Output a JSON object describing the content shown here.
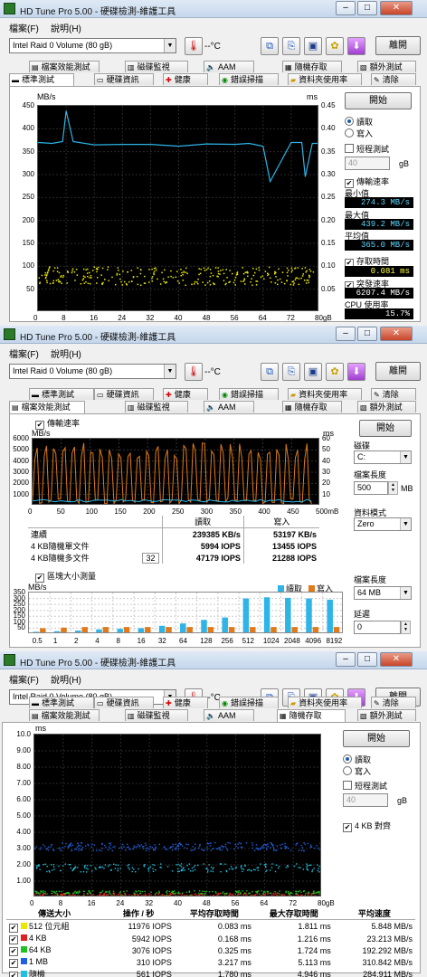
{
  "app": {
    "title": "HD Tune Pro  5.00 - 硬碟檢測-維護工具",
    "menu": [
      "檔案(F)",
      "說明(H)"
    ],
    "drive": "Intel   Raid 0 Volume (80 gB)",
    "temperature": "--°C",
    "exit_label": "離開",
    "window_buttons": {
      "minimize": "–",
      "maximize": "□",
      "close": "✕"
    }
  },
  "tabs": {
    "row_top": [
      "檔案效能測試",
      "磁碟監視",
      "AAM",
      "隨機存取",
      "額外測試"
    ],
    "row_bottom": [
      "標準測試",
      "硬碟資訊",
      "健康",
      "錯誤掃描",
      "資料夾使用率",
      "清除"
    ]
  },
  "panel1": {
    "start_label": "開始",
    "read_label": "讀取",
    "write_label": "寫入",
    "short_stroke_label": "短程測試",
    "short_stroke_value": "40",
    "short_stroke_unit": "gB",
    "transfer_rate_label": "傳輸速率",
    "min_label": "最小值",
    "min_value": "274.3 MB/s",
    "max_label": "最大值",
    "max_value": "439.2 MB/s",
    "avg_label": "平均值",
    "avg_value": "365.0 MB/s",
    "access_time_label": "存取時間",
    "access_time_value": "0.081 ms",
    "burst_rate_label": "突發速率",
    "burst_rate_value": "6207.4 MB/s",
    "cpu_label": "CPU 使用率",
    "cpu_value": "15.7%",
    "chart": {
      "y_unit_left": "MB/s",
      "y_unit_right": "ms",
      "y_ticks_left": [
        "450",
        "400",
        "350",
        "300",
        "250",
        "200",
        "150",
        "100",
        "50"
      ],
      "y_ticks_right": [
        "0.45",
        "0.40",
        "0.35",
        "0.30",
        "0.25",
        "0.20",
        "0.15",
        "0.10",
        "0.05"
      ],
      "x_ticks": [
        "0",
        "8",
        "16",
        "24",
        "32",
        "40",
        "48",
        "56",
        "64",
        "72",
        "80gB"
      ]
    }
  },
  "panel2": {
    "transfer_rate_label": "傳輸速率",
    "start_label": "開始",
    "disk_label": "磁碟",
    "disk_value": "C:",
    "file_length_label": "檔案長度",
    "file_length_value": "500",
    "file_length_unit": "MB",
    "data_pattern_label": "資料模式",
    "data_pattern_value": "Zero",
    "chart": {
      "y_unit_left": "MB/s",
      "y_unit_right": "ms",
      "y_ticks_left": [
        "6000",
        "5000",
        "4000",
        "3000",
        "2000",
        "1000"
      ],
      "y_ticks_right": [
        "60",
        "50",
        "40",
        "30",
        "20",
        "10"
      ],
      "x_ticks": [
        "0",
        "50",
        "100",
        "150",
        "200",
        "250",
        "300",
        "350",
        "400",
        "450",
        "500mB"
      ]
    },
    "table": {
      "headers": [
        "",
        "",
        "讀取",
        "寫入"
      ],
      "rows": [
        {
          "label": "連續",
          "read": "239385 KB/s",
          "write": "53197 KB/s"
        },
        {
          "label": "4 KB隨機單文件",
          "read": "5994 IOPS",
          "write": "13455 IOPS"
        },
        {
          "label": "4 KB隨機多文件",
          "qd": "32",
          "read": "47179 IOPS",
          "write": "21288 IOPS"
        }
      ]
    },
    "block_label": "區塊大小測量",
    "legend_read": "讀取",
    "legend_write": "寫入",
    "block_chart": {
      "y_unit": "MB/s",
      "y_ticks": [
        "350",
        "300",
        "250",
        "200",
        "150",
        "100",
        "50"
      ],
      "x_ticks": [
        "0.5",
        "1",
        "2",
        "4",
        "8",
        "16",
        "32",
        "64",
        "128",
        "256",
        "512",
        "1024",
        "2048",
        "4096",
        "8192"
      ]
    },
    "file_length2_label": "檔案長度",
    "file_length2_value": "64 MB",
    "delay_label": "延遲",
    "delay_value": "0"
  },
  "panel3": {
    "start_label": "開始",
    "read_label": "讀取",
    "write_label": "寫入",
    "short_stroke_label": "短程測試",
    "short_stroke_value": "40",
    "short_stroke_unit": "gB",
    "align_label": "4 KB 對齊",
    "chart": {
      "y_unit": "ms",
      "y_ticks": [
        "10.0",
        "9.00",
        "8.00",
        "7.00",
        "6.00",
        "5.00",
        "4.00",
        "3.00",
        "2.00",
        "1.00"
      ],
      "x_ticks": [
        "0",
        "8",
        "16",
        "24",
        "32",
        "40",
        "48",
        "56",
        "64",
        "72",
        "80gB"
      ]
    },
    "table": {
      "headers": [
        "傳送大小",
        "操作 / 秒",
        "平均存取時間",
        "最大存取時間",
        "平均速度"
      ],
      "rows": [
        {
          "label": "512 位元組",
          "ops": "11976 IOPS",
          "avg": "0.083 ms",
          "max": "1.811 ms",
          "speed": "5.848 MB/s",
          "color": "#e8e800"
        },
        {
          "label": "4 KB",
          "ops": "5942 IOPS",
          "avg": "0.168 ms",
          "max": "1.216 ms",
          "speed": "23.213 MB/s",
          "color": "#e02020"
        },
        {
          "label": "64 KB",
          "ops": "3076 IOPS",
          "avg": "0.325 ms",
          "max": "1.724 ms",
          "speed": "192.292 MB/s",
          "color": "#20c020"
        },
        {
          "label": "1 MB",
          "ops": "310 IOPS",
          "avg": "3.217 ms",
          "max": "5.113 ms",
          "speed": "310.842 MB/s",
          "color": "#2060e0"
        },
        {
          "label": "隨機",
          "ops": "561 IOPS",
          "avg": "1.780 ms",
          "max": "4.946 ms",
          "speed": "284.911 MB/s",
          "color": "#20c0e0"
        }
      ]
    }
  },
  "chart_data": [
    {
      "type": "line",
      "x": [
        0,
        4,
        7,
        8,
        10,
        16,
        24,
        32,
        40,
        48,
        56,
        60,
        64,
        66,
        72,
        75,
        76,
        78,
        80
      ],
      "series": [
        {
          "values": [
            370,
            368,
            372,
            439,
            372,
            365,
            366,
            366,
            362,
            367,
            366,
            368,
            362,
            285,
            370,
            370,
            295,
            368,
            368
          ]
        }
      ],
      "ylim": [
        0,
        450
      ],
      "access_time_ms_band": [
        0.06,
        0.1
      ],
      "colors": {
        "transfer": "#2eb4e6",
        "access": "#e8e800"
      }
    },
    {
      "type": "bar",
      "series": [
        {
          "name": "讀取",
          "values": [
            20,
            25,
            30,
            40,
            45,
            50,
            70,
            90,
            120,
            140,
            300,
            310,
            305,
            300,
            290
          ]
        },
        {
          "name": "寫入",
          "values": [
            50,
            55,
            60,
            60,
            60,
            60,
            60,
            60,
            60,
            60,
            60,
            60,
            60,
            60,
            60
          ]
        }
      ],
      "categories": [
        "0.5",
        "1",
        "2",
        "4",
        "8",
        "16",
        "32",
        "64",
        "128",
        "256",
        "512",
        "1024",
        "2048",
        "4096",
        "8192"
      ],
      "ylim": [
        0,
        350
      ],
      "colors": {
        "read": "#2eb4e6",
        "write": "#e07a1a"
      }
    }
  ]
}
